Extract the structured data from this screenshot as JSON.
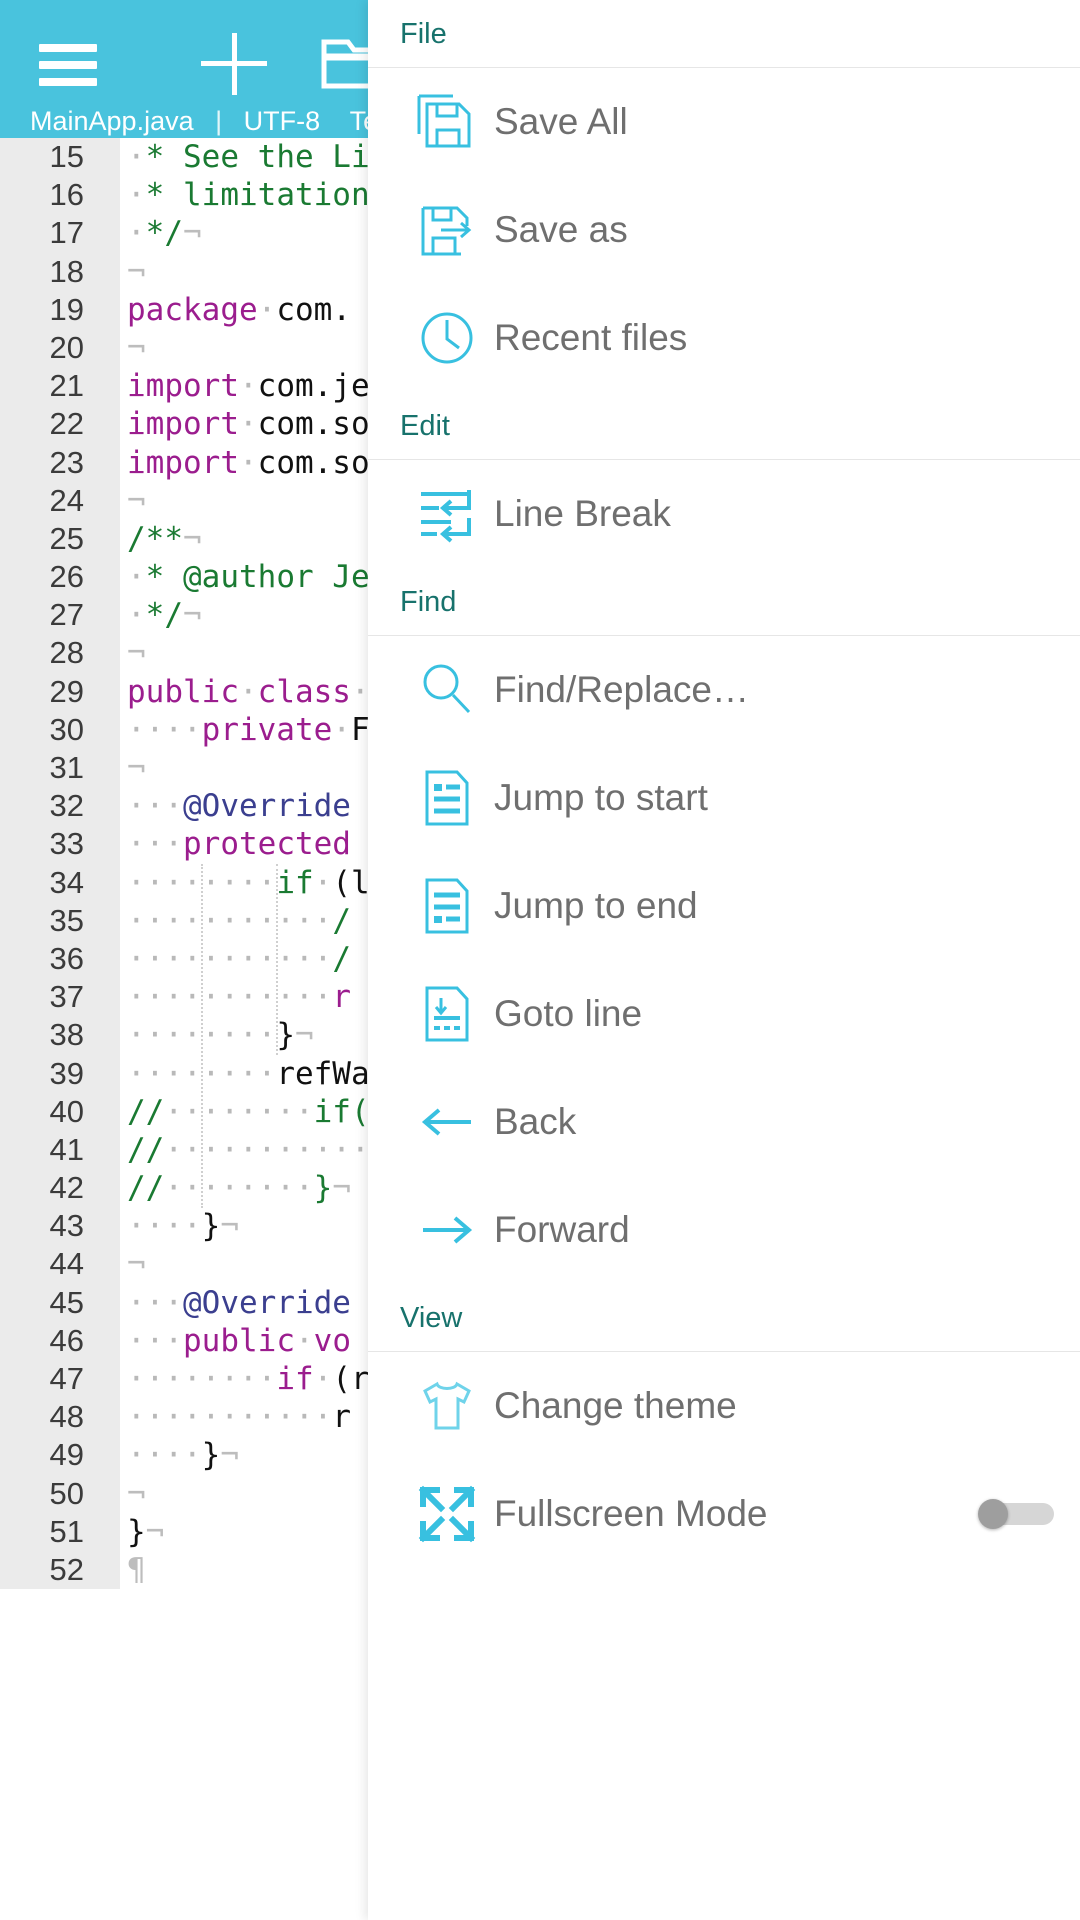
{
  "app": {
    "status_file": "MainApp.java",
    "status_sep": "|",
    "status_encoding": "UTF-8",
    "status_type": "Text",
    "accent_color": "#49c3dd",
    "section_color": "#17726c",
    "label_color": "#6f6f6f"
  },
  "toolbar": {
    "menu_icon": "hamburger-menu-icon",
    "new_icon": "plus-new-file-icon",
    "open_icon": "folder-open-icon"
  },
  "editor": {
    "first_line": 15,
    "lines": [
      {
        "n": 15,
        "fold": false,
        "tokens": [
          {
            "t": "ws",
            "v": "·"
          },
          {
            "t": "cm",
            "v": "* See the Li"
          }
        ]
      },
      {
        "n": 16,
        "fold": false,
        "tokens": [
          {
            "t": "ws",
            "v": "·"
          },
          {
            "t": "cm",
            "v": "* limitation"
          }
        ]
      },
      {
        "n": 17,
        "fold": false,
        "tokens": [
          {
            "t": "ws",
            "v": "·"
          },
          {
            "t": "cm",
            "v": "*/"
          },
          {
            "t": "eol",
            "v": "¬"
          }
        ]
      },
      {
        "n": 18,
        "fold": false,
        "tokens": [
          {
            "t": "eol",
            "v": "¬"
          }
        ]
      },
      {
        "n": 19,
        "fold": false,
        "tokens": [
          {
            "t": "kw",
            "v": "package"
          },
          {
            "t": "ws",
            "v": "·"
          },
          {
            "t": "pl",
            "v": "com."
          }
        ]
      },
      {
        "n": 20,
        "fold": false,
        "tokens": [
          {
            "t": "eol",
            "v": "¬"
          }
        ]
      },
      {
        "n": 21,
        "fold": false,
        "tokens": [
          {
            "t": "kw",
            "v": "import"
          },
          {
            "t": "ws",
            "v": "·"
          },
          {
            "t": "pl",
            "v": "com.je"
          }
        ]
      },
      {
        "n": 22,
        "fold": false,
        "tokens": [
          {
            "t": "kw",
            "v": "import"
          },
          {
            "t": "ws",
            "v": "·"
          },
          {
            "t": "pl",
            "v": "com.so"
          }
        ]
      },
      {
        "n": 23,
        "fold": false,
        "tokens": [
          {
            "t": "kw",
            "v": "import"
          },
          {
            "t": "ws",
            "v": "·"
          },
          {
            "t": "pl",
            "v": "com.so"
          }
        ]
      },
      {
        "n": 24,
        "fold": false,
        "tokens": [
          {
            "t": "eol",
            "v": "¬"
          }
        ]
      },
      {
        "n": 25,
        "fold": true,
        "tokens": [
          {
            "t": "cm",
            "v": "/**"
          },
          {
            "t": "eol",
            "v": "¬"
          }
        ]
      },
      {
        "n": 26,
        "fold": false,
        "tokens": [
          {
            "t": "ws",
            "v": "·"
          },
          {
            "t": "cm",
            "v": "* @author Je"
          }
        ]
      },
      {
        "n": 27,
        "fold": false,
        "tokens": [
          {
            "t": "ws",
            "v": "·"
          },
          {
            "t": "cm",
            "v": "*/"
          },
          {
            "t": "eol",
            "v": "¬"
          }
        ]
      },
      {
        "n": 28,
        "fold": false,
        "tokens": [
          {
            "t": "eol",
            "v": "¬"
          }
        ]
      },
      {
        "n": 29,
        "fold": true,
        "tokens": [
          {
            "t": "kw",
            "v": "public"
          },
          {
            "t": "ws",
            "v": "·"
          },
          {
            "t": "kw",
            "v": "class"
          },
          {
            "t": "ws",
            "v": "·"
          }
        ]
      },
      {
        "n": 30,
        "fold": false,
        "tokens": [
          {
            "t": "ws",
            "v": "····"
          },
          {
            "t": "kw",
            "v": "private"
          },
          {
            "t": "ws",
            "v": "·"
          },
          {
            "t": "pl",
            "v": "F"
          }
        ]
      },
      {
        "n": 31,
        "fold": false,
        "tokens": [
          {
            "t": "eol",
            "v": "¬"
          }
        ]
      },
      {
        "n": 32,
        "fold": false,
        "tokens": [
          {
            "t": "ws",
            "v": "···"
          },
          {
            "t": "an",
            "v": "@Override"
          }
        ]
      },
      {
        "n": 33,
        "fold": true,
        "tokens": [
          {
            "t": "ws",
            "v": "···"
          },
          {
            "t": "kw",
            "v": "protected"
          }
        ]
      },
      {
        "n": 34,
        "fold": true,
        "tokens": [
          {
            "t": "ws",
            "v": "········"
          },
          {
            "t": "cm",
            "v": "if"
          },
          {
            "t": "ws",
            "v": "·"
          },
          {
            "t": "pl",
            "v": "(l"
          }
        ]
      },
      {
        "n": 35,
        "fold": false,
        "tokens": [
          {
            "t": "ws",
            "v": "···········"
          },
          {
            "t": "cm",
            "v": "/"
          }
        ]
      },
      {
        "n": 36,
        "fold": false,
        "tokens": [
          {
            "t": "ws",
            "v": "···········"
          },
          {
            "t": "cm",
            "v": "/"
          }
        ]
      },
      {
        "n": 37,
        "fold": false,
        "tokens": [
          {
            "t": "ws",
            "v": "···········"
          },
          {
            "t": "kw",
            "v": "r"
          }
        ]
      },
      {
        "n": 38,
        "fold": false,
        "tokens": [
          {
            "t": "ws",
            "v": "········"
          },
          {
            "t": "pl",
            "v": "}"
          },
          {
            "t": "eol",
            "v": "¬"
          }
        ]
      },
      {
        "n": 39,
        "fold": false,
        "tokens": [
          {
            "t": "ws",
            "v": "········"
          },
          {
            "t": "pl",
            "v": "refWa"
          }
        ]
      },
      {
        "n": 40,
        "fold": true,
        "tokens": [
          {
            "t": "cm",
            "v": "//"
          },
          {
            "t": "ws",
            "v": "········"
          },
          {
            "t": "cm",
            "v": "if("
          }
        ]
      },
      {
        "n": 41,
        "fold": false,
        "tokens": [
          {
            "t": "cm",
            "v": "//"
          },
          {
            "t": "ws",
            "v": "···········"
          }
        ]
      },
      {
        "n": 42,
        "fold": false,
        "tokens": [
          {
            "t": "cm",
            "v": "//"
          },
          {
            "t": "ws",
            "v": "········"
          },
          {
            "t": "cm",
            "v": "}"
          },
          {
            "t": "eol",
            "v": "¬"
          }
        ]
      },
      {
        "n": 43,
        "fold": false,
        "tokens": [
          {
            "t": "ws",
            "v": "····"
          },
          {
            "t": "pl",
            "v": "}"
          },
          {
            "t": "eol",
            "v": "¬"
          }
        ]
      },
      {
        "n": 44,
        "fold": false,
        "tokens": [
          {
            "t": "eol",
            "v": "¬"
          }
        ]
      },
      {
        "n": 45,
        "fold": false,
        "tokens": [
          {
            "t": "ws",
            "v": "···"
          },
          {
            "t": "an",
            "v": "@Override"
          }
        ]
      },
      {
        "n": 46,
        "fold": true,
        "tokens": [
          {
            "t": "ws",
            "v": "···"
          },
          {
            "t": "kw",
            "v": "public"
          },
          {
            "t": "ws",
            "v": "·"
          },
          {
            "t": "kw",
            "v": "vo"
          }
        ]
      },
      {
        "n": 47,
        "fold": false,
        "tokens": [
          {
            "t": "ws",
            "v": "········"
          },
          {
            "t": "kw",
            "v": "if"
          },
          {
            "t": "ws",
            "v": "·"
          },
          {
            "t": "pl",
            "v": "(r"
          }
        ]
      },
      {
        "n": 48,
        "fold": false,
        "tokens": [
          {
            "t": "ws",
            "v": "···········"
          },
          {
            "t": "pl",
            "v": "r"
          }
        ]
      },
      {
        "n": 49,
        "fold": false,
        "tokens": [
          {
            "t": "ws",
            "v": "····"
          },
          {
            "t": "pl",
            "v": "}"
          },
          {
            "t": "eol",
            "v": "¬"
          }
        ]
      },
      {
        "n": 50,
        "fold": false,
        "tokens": [
          {
            "t": "eol",
            "v": "¬"
          }
        ]
      },
      {
        "n": 51,
        "fold": false,
        "tokens": [
          {
            "t": "pl",
            "v": "}"
          },
          {
            "t": "eol",
            "v": "¬"
          }
        ]
      },
      {
        "n": 52,
        "fold": false,
        "tokens": [
          {
            "t": "eol",
            "v": "¶"
          }
        ]
      }
    ]
  },
  "menu": {
    "sections": [
      {
        "title": "File",
        "items": [
          {
            "label": "Save All",
            "icon": "save-all-icon",
            "toggle": null
          },
          {
            "label": "Save as",
            "icon": "save-as-icon",
            "toggle": null
          },
          {
            "label": "Recent files",
            "icon": "clock-icon",
            "toggle": null
          }
        ]
      },
      {
        "title": "Edit",
        "items": [
          {
            "label": "Line Break",
            "icon": "line-break-icon",
            "toggle": null
          }
        ]
      },
      {
        "title": "Find",
        "items": [
          {
            "label": "Find/Replace…",
            "icon": "search-icon",
            "toggle": null
          },
          {
            "label": "Jump to start",
            "icon": "jump-to-start-icon",
            "toggle": null
          },
          {
            "label": "Jump to end",
            "icon": "jump-to-end-icon",
            "toggle": null
          },
          {
            "label": "Goto line",
            "icon": "goto-line-icon",
            "toggle": null
          },
          {
            "label": "Back",
            "icon": "arrow-left-icon",
            "toggle": null
          },
          {
            "label": "Forward",
            "icon": "arrow-right-icon",
            "toggle": null
          }
        ]
      },
      {
        "title": "View",
        "items": [
          {
            "label": "Change theme",
            "icon": "tshirt-icon",
            "toggle": null
          },
          {
            "label": "Fullscreen Mode",
            "icon": "fullscreen-icon",
            "toggle": "off"
          }
        ]
      }
    ]
  }
}
